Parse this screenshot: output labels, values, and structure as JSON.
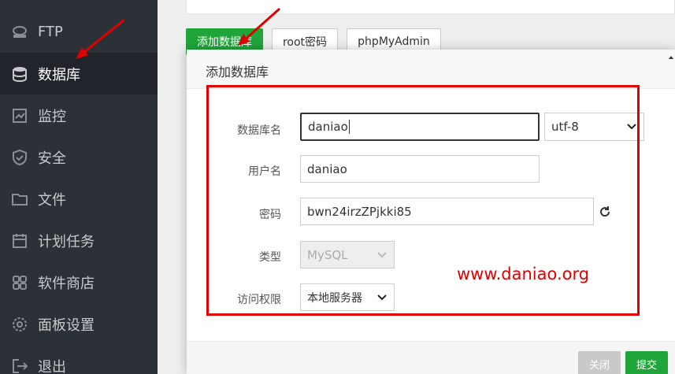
{
  "sidebar": {
    "items": [
      {
        "label": "FTP",
        "icon": "ftp-icon",
        "active": false
      },
      {
        "label": "数据库",
        "icon": "database-icon",
        "active": true
      },
      {
        "label": "监控",
        "icon": "monitor-icon",
        "active": false
      },
      {
        "label": "安全",
        "icon": "shield-icon",
        "active": false
      },
      {
        "label": "文件",
        "icon": "folder-icon",
        "active": false
      },
      {
        "label": "计划任务",
        "icon": "calendar-icon",
        "active": false
      },
      {
        "label": "软件商店",
        "icon": "grid-icon",
        "active": false
      },
      {
        "label": "面板设置",
        "icon": "gear-icon",
        "active": false
      },
      {
        "label": "退出",
        "icon": "logout-icon",
        "active": false
      }
    ]
  },
  "toolbar": {
    "add_db_label": "添加数据库",
    "root_pwd_label": "root密码",
    "phpmyadmin_label": "phpMyAdmin"
  },
  "modal": {
    "title": "添加数据库",
    "fields": {
      "db_name_label": "数据库名",
      "db_name_value": "daniao",
      "charset_value": "utf-8",
      "username_label": "用户名",
      "username_value": "daniao",
      "password_label": "密码",
      "password_value": "bwn24irzZPjkki85",
      "type_label": "类型",
      "type_value": "MySQL",
      "access_label": "访问权限",
      "access_value": "本地服务器"
    },
    "close_label": "关闭",
    "submit_label": "提交"
  },
  "watermark": "www.daniao.org",
  "colors": {
    "sidebar_bg": "#2c3138",
    "accent_green": "#20a53a",
    "annotation_red": "#e00000"
  }
}
